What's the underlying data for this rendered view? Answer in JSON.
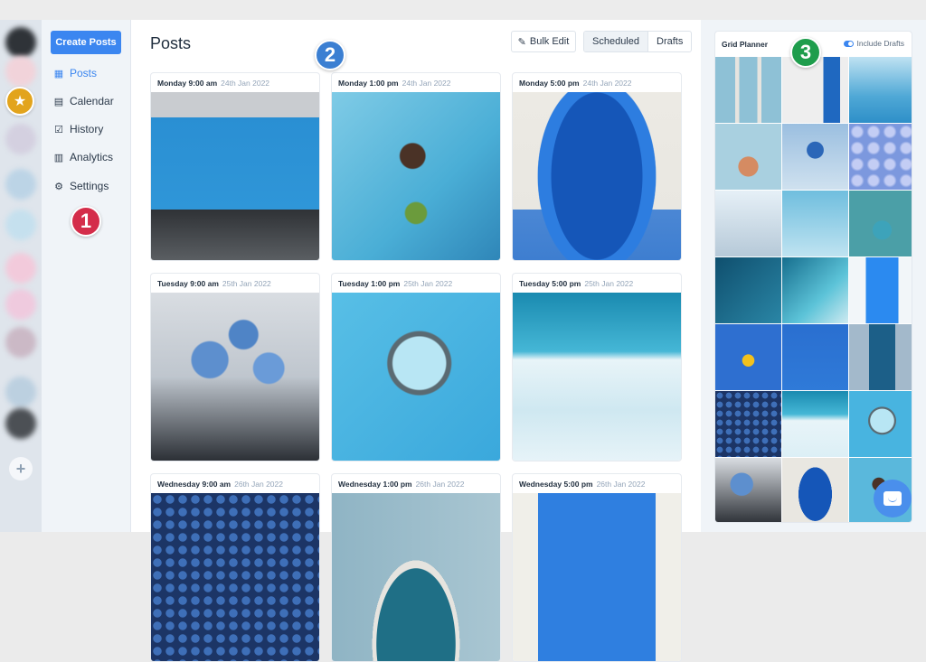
{
  "sidebar": {
    "create_label": "Create Posts",
    "items": [
      {
        "label": "Posts",
        "icon": "grid-icon",
        "active": true
      },
      {
        "label": "Calendar",
        "icon": "calendar-icon"
      },
      {
        "label": "History",
        "icon": "calendar-check-icon"
      },
      {
        "label": "Analytics",
        "icon": "bar-chart-icon"
      },
      {
        "label": "Settings",
        "icon": "gear-icon"
      }
    ],
    "add_label": "+"
  },
  "badges": [
    "1",
    "2",
    "3"
  ],
  "main": {
    "title": "Posts",
    "bulk_edit_label": "Bulk Edit",
    "tabs": [
      {
        "label": "Scheduled",
        "active": true
      },
      {
        "label": "Drafts"
      }
    ],
    "posts": [
      {
        "time": "Monday 9:00 am",
        "date": "24th Jan 2022",
        "image": "blue food truck"
      },
      {
        "time": "Monday 1:00 pm",
        "date": "24th Jan 2022",
        "image": "blue wall with window"
      },
      {
        "time": "Monday 5:00 pm",
        "date": "24th Jan 2022",
        "image": "blue arched door"
      },
      {
        "time": "Tuesday 9:00 am",
        "date": "25th Jan 2022",
        "image": "blue flowers"
      },
      {
        "time": "Tuesday 1:00 pm",
        "date": "25th Jan 2022",
        "image": "magnifying glass"
      },
      {
        "time": "Tuesday 5:00 pm",
        "date": "25th Jan 2022",
        "image": "snowy dunes"
      },
      {
        "time": "Wednesday 9:00 am",
        "date": "26th Jan 2022",
        "image": "blueberries"
      },
      {
        "time": "Wednesday 1:00 pm",
        "date": "26th Jan 2022",
        "image": "tiled doorway"
      },
      {
        "time": "Wednesday 5:00 pm",
        "date": "26th Jan 2022",
        "image": "blue shutters"
      }
    ]
  },
  "grid_planner": {
    "title": "Grid Planner",
    "toggle_label": "Include Drafts",
    "toggle_on": true
  },
  "colors": {
    "accent": "#3b86f0",
    "badge1": "#d42d4a",
    "badge2": "#3b7fd2",
    "badge3": "#1e9d4c",
    "star": "#e2a41d"
  }
}
